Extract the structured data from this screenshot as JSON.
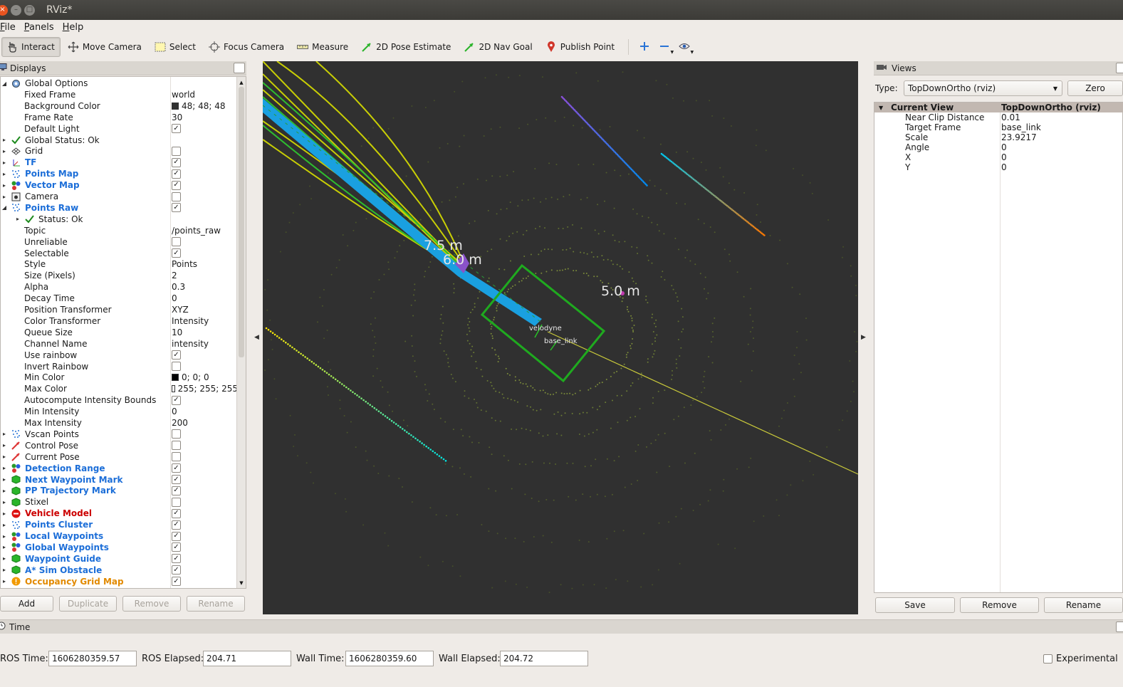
{
  "window": {
    "title": "RViz*"
  },
  "menu": [
    "File",
    "Panels",
    "Help"
  ],
  "toolbar": {
    "tools": [
      {
        "label": "Interact",
        "icon": "hand-pointer-icon",
        "active": true
      },
      {
        "label": "Move Camera",
        "icon": "move-camera-icon"
      },
      {
        "label": "Select",
        "icon": "select-icon"
      },
      {
        "label": "Focus Camera",
        "icon": "focus-camera-icon"
      },
      {
        "label": "Measure",
        "icon": "ruler-icon"
      },
      {
        "label": "2D Pose Estimate",
        "icon": "pose-arrow-icon"
      },
      {
        "label": "2D Nav Goal",
        "icon": "nav-goal-arrow-icon"
      },
      {
        "label": "Publish Point",
        "icon": "map-pin-icon"
      }
    ]
  },
  "displays": {
    "title": "Displays",
    "global_options": {
      "label": "Global Options",
      "fixed_frame_label": "Fixed Frame",
      "fixed_frame": "world",
      "bg_color_label": "Background Color",
      "bg_color": "48; 48; 48",
      "frame_rate_label": "Frame Rate",
      "frame_rate": "30",
      "default_light_label": "Default Light"
    },
    "global_status": "Global Status: Ok",
    "items_top": [
      {
        "label": "Grid",
        "style": "normal",
        "checked": false
      },
      {
        "label": "TF",
        "style": "blue",
        "checked": true
      },
      {
        "label": "Points Map",
        "style": "blue",
        "checked": true
      },
      {
        "label": "Vector Map",
        "style": "blue",
        "checked": true
      },
      {
        "label": "Camera",
        "style": "normal",
        "checked": false
      }
    ],
    "points_raw": {
      "label": "Points Raw",
      "status": "Status: Ok",
      "props": [
        {
          "k": "Topic",
          "v": "/points_raw"
        },
        {
          "k": "Unreliable",
          "cb": false
        },
        {
          "k": "Selectable",
          "cb": true
        },
        {
          "k": "Style",
          "v": "Points"
        },
        {
          "k": "Size (Pixels)",
          "v": "2"
        },
        {
          "k": "Alpha",
          "v": "0.3"
        },
        {
          "k": "Decay Time",
          "v": "0"
        },
        {
          "k": "Position Transformer",
          "v": "XYZ"
        },
        {
          "k": "Color Transformer",
          "v": "Intensity"
        },
        {
          "k": "Queue Size",
          "v": "10"
        },
        {
          "k": "Channel Name",
          "v": "intensity"
        },
        {
          "k": "Use rainbow",
          "cb": true
        },
        {
          "k": "Invert Rainbow",
          "cb": false
        },
        {
          "k": "Min Color",
          "v": "0; 0; 0",
          "swatch": "#000000"
        },
        {
          "k": "Max Color",
          "v": "255; 255; 255",
          "swatch": "#ffffff"
        },
        {
          "k": "Autocompute Intensity Bounds",
          "cb": true
        },
        {
          "k": "Min Intensity",
          "v": "0"
        },
        {
          "k": "Max Intensity",
          "v": "200"
        }
      ]
    },
    "items_bottom": [
      {
        "label": "Vscan Points",
        "style": "normal",
        "checked": false
      },
      {
        "label": "Control Pose",
        "style": "normal",
        "checked": false
      },
      {
        "label": "Current Pose",
        "style": "normal",
        "checked": false
      },
      {
        "label": "Detection Range",
        "style": "blue",
        "checked": true
      },
      {
        "label": "Next Waypoint Mark",
        "style": "blue",
        "checked": true
      },
      {
        "label": "PP Trajectory Mark",
        "style": "blue",
        "checked": true
      },
      {
        "label": "Stixel",
        "style": "normal",
        "checked": false
      },
      {
        "label": "Vehicle Model",
        "style": "red",
        "checked": true
      },
      {
        "label": "Points Cluster",
        "style": "blue",
        "checked": true
      },
      {
        "label": "Local Waypoints",
        "style": "blue",
        "checked": true
      },
      {
        "label": "Global Waypoints",
        "style": "blue",
        "checked": true
      },
      {
        "label": "Waypoint Guide",
        "style": "blue",
        "checked": true
      },
      {
        "label": "A* Sim Obstacle",
        "style": "blue",
        "checked": true
      },
      {
        "label": "Occupancy Grid Map",
        "style": "orange",
        "checked": true
      }
    ],
    "buttons": {
      "add": "Add",
      "duplicate": "Duplicate",
      "remove": "Remove",
      "rename": "Rename"
    }
  },
  "viewport": {
    "labels": {
      "r75": "7.5  m",
      "r60": "6.0  m",
      "r50": "5.0  m",
      "velodyne": "velodyne",
      "base_link": "base_link"
    },
    "colors": {
      "background": "#303030",
      "vehicle_box": "#1faa1f",
      "trajectory": "#e6e600",
      "waypoints": "#00b8e6"
    }
  },
  "views": {
    "title": "Views",
    "type_label": "Type:",
    "type_value": "TopDownOrtho (rviz)",
    "zero": "Zero",
    "current_view": {
      "label": "Current View",
      "value": "TopDownOrtho (rviz)"
    },
    "props": [
      {
        "k": "Near Clip Distance",
        "v": "0.01"
      },
      {
        "k": "Target Frame",
        "v": "base_link"
      },
      {
        "k": "Scale",
        "v": "23.9217"
      },
      {
        "k": "Angle",
        "v": "0"
      },
      {
        "k": "X",
        "v": "0"
      },
      {
        "k": "Y",
        "v": "0"
      }
    ],
    "buttons": {
      "save": "Save",
      "remove": "Remove",
      "rename": "Rename"
    }
  },
  "time": {
    "title": "Time",
    "ros_time_label": "ROS Time:",
    "ros_time": "1606280359.57",
    "ros_elapsed_label": "ROS Elapsed:",
    "ros_elapsed": "204.71",
    "wall_time_label": "Wall Time:",
    "wall_time": "1606280359.60",
    "wall_elapsed_label": "Wall Elapsed:",
    "wall_elapsed": "204.72",
    "experimental_label": "Experimental"
  }
}
